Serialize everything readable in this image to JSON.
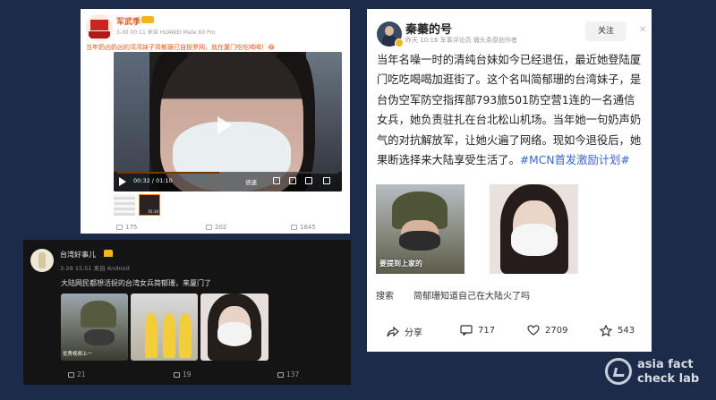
{
  "card1": {
    "author": "军武季",
    "meta": "3-30 00:11 来自 HUAWEI Mate 60 Pro",
    "text": "当年奶凶奶凶的湾湾妹子简郁珊已自投罗网，就在厦门吃吃喝喝！😂",
    "video": {
      "current_time": "00:32",
      "duration": "01:10",
      "speed_label": "倍速",
      "progress": 0.46
    },
    "thumb2_label": "01:10",
    "actions": {
      "share": "175",
      "comment": "202",
      "like": "1845"
    }
  },
  "card2": {
    "author": "台湾好事儿",
    "meta": "3-28 15:51 来自 Android",
    "text": "大陆网民都想活捉的台湾女兵简郁珊，来厦门了",
    "img1_caption": "优秀视频上一",
    "actions": {
      "share": "21",
      "comment": "19",
      "like": "137"
    }
  },
  "card3": {
    "author": "秦蓁的号",
    "meta": "昨天 10:16 军事评论员 微头条原创作者",
    "follow_label": "关注",
    "text": "当年名噪一时的清纯台妹如今已经退伍，最近她登陆厦门吃吃喝喝加逛街了。这个名叫简郁珊的台湾妹子，是台伪空军防空指挥部793旅501防空营1连的一名通信女兵，她负责驻扎在台北松山机场。当年她一句奶声奶气的对抗解放军，让她火遍了网络。现如今退役后，她果断选择来大陆享受生活了。",
    "hashtag": "#MCN首发激励计划#",
    "img1_caption": "要提到上家的",
    "search_label": "搜索",
    "search_query": "简郁珊知道自己在大陆火了吗",
    "actions": {
      "share": "分享",
      "comment": "717",
      "like": "2709",
      "favorite": "543"
    }
  },
  "watermark": {
    "line1": "asia fact",
    "line2": "check lab"
  }
}
